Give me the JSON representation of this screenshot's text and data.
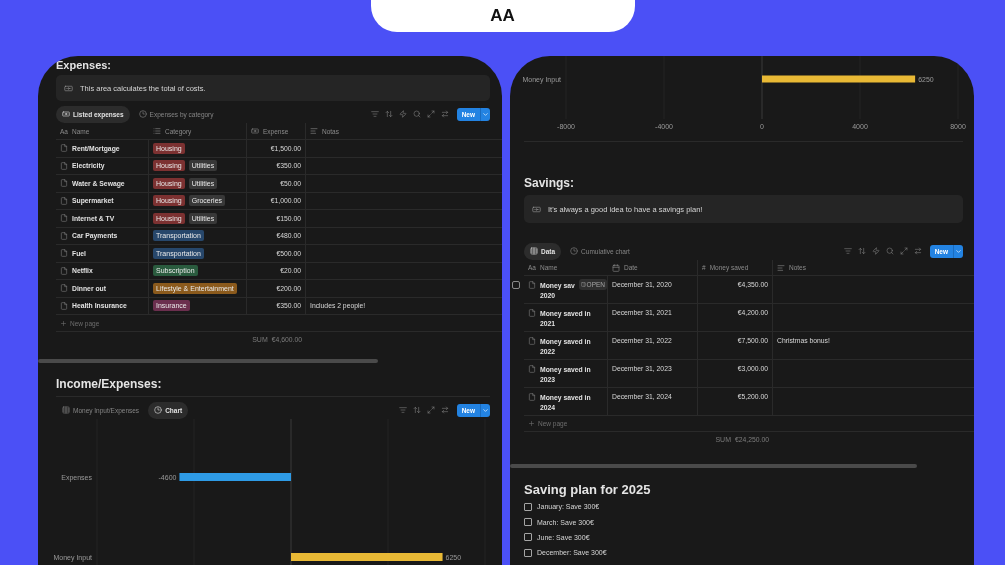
{
  "header": {
    "title": "AA"
  },
  "expenses": {
    "title": "Expenses:",
    "callout": "This area calculates the total of costs.",
    "views": [
      {
        "label": "Listed expenses",
        "kind": "money",
        "selected": true
      },
      {
        "label": "Expenses by category",
        "kind": "chart",
        "selected": false
      }
    ],
    "new_button": "New",
    "columns": [
      {
        "label": "Name",
        "kind": "title",
        "glyph": "Aa"
      },
      {
        "label": "Category",
        "kind": "multi_select"
      },
      {
        "label": "Expense",
        "kind": "currency"
      },
      {
        "label": "Notas",
        "kind": "text"
      }
    ],
    "rows": [
      {
        "name": "Rent/Mortgage",
        "tags": [
          {
            "label": "Housing",
            "color": "#7c3131"
          }
        ],
        "expense": "€1,500.00"
      },
      {
        "name": "Electricity",
        "tags": [
          {
            "label": "Housing",
            "color": "#7c3131"
          },
          {
            "label": "Utilities",
            "color": "#383838"
          }
        ],
        "expense": "€350.00"
      },
      {
        "name": "Water & Sewage",
        "tags": [
          {
            "label": "Housing",
            "color": "#7c3131"
          },
          {
            "label": "Utilities",
            "color": "#383838"
          }
        ],
        "expense": "€50.00"
      },
      {
        "name": "Supermarket",
        "tags": [
          {
            "label": "Housing",
            "color": "#7c3131"
          },
          {
            "label": "Groceries",
            "color": "#383838"
          }
        ],
        "expense": "€1,000.00"
      },
      {
        "name": "Internet & TV",
        "tags": [
          {
            "label": "Housing",
            "color": "#7c3131"
          },
          {
            "label": "Utilities",
            "color": "#383838"
          }
        ],
        "expense": "€150.00"
      },
      {
        "name": "Car Payments",
        "tags": [
          {
            "label": "Transportation",
            "color": "#27476b"
          }
        ],
        "expense": "€480.00"
      },
      {
        "name": "Fuel",
        "tags": [
          {
            "label": "Transportation",
            "color": "#27476b"
          }
        ],
        "expense": "€500.00"
      },
      {
        "name": "Netflix",
        "tags": [
          {
            "label": "Subscription",
            "color": "#2a5b3e"
          }
        ],
        "expense": "€20.00"
      },
      {
        "name": "Dinner out",
        "tags": [
          {
            "label": "Lifestyle & Entertainment",
            "color": "#8b5a1c"
          }
        ],
        "expense": "€200.00"
      },
      {
        "name": "Health Insurance",
        "tags": [
          {
            "label": "Insurance",
            "color": "#6b2f4e"
          }
        ],
        "expense": "€350.00",
        "notes": "Includes 2 people!"
      }
    ],
    "new_page": "New page",
    "sum_label": "SUM",
    "sum": "€4,600.00"
  },
  "income_expenses": {
    "title": "Income/Expenses:",
    "views": [
      {
        "label": "Money Input/Expenses",
        "kind": "table",
        "selected": false
      },
      {
        "label": "Chart",
        "kind": "chart",
        "selected": true
      }
    ],
    "new_button": "New",
    "chart_data": {
      "type": "bar",
      "orientation": "horizontal",
      "categories": [
        "Expenses",
        "Money Input"
      ],
      "data_labels": true,
      "series": [
        {
          "color": "#2e9be6",
          "values": [
            -4600,
            null
          ]
        },
        {
          "color": "#e9b935",
          "values": [
            null,
            6250
          ]
        }
      ]
    }
  },
  "income_chart_continued": {
    "chart_data": {
      "type": "bar",
      "orientation": "horizontal",
      "categories": [
        "Money Input"
      ],
      "xlim": [
        -8000,
        8000
      ],
      "xticks": [
        -8000,
        -4000,
        0,
        4000,
        8000
      ],
      "data_labels": true,
      "series": [
        {
          "color": "#e9b935",
          "values": [
            6250
          ]
        }
      ]
    }
  },
  "savings": {
    "title": "Savings:",
    "callout": "It's always a good idea to have a savings plan!",
    "views": [
      {
        "label": "Data",
        "kind": "table",
        "selected": true
      },
      {
        "label": "Cumulative chart",
        "kind": "chart",
        "selected": false
      }
    ],
    "new_button": "New",
    "columns": [
      {
        "label": "Name",
        "kind": "title",
        "glyph": "Aa"
      },
      {
        "label": "Date",
        "kind": "date"
      },
      {
        "label": "Money saved",
        "kind": "number",
        "glyph": "#"
      },
      {
        "label": "Notes",
        "kind": "text"
      }
    ],
    "rows": [
      {
        "name_lines": [
          "Money sav",
          "2020"
        ],
        "open_label": "OPEN",
        "selected": false,
        "date": "December 31, 2020",
        "amount": "€4,350.00"
      },
      {
        "name_lines": [
          "Money saved in",
          "2021"
        ],
        "selected": false,
        "date": "December 31, 2021",
        "amount": "€4,200.00"
      },
      {
        "name_lines": [
          "Money saved in",
          "2022"
        ],
        "selected": false,
        "date": "December 31, 2022",
        "amount": "€7,500.00",
        "notes": "Christmas bonus!"
      },
      {
        "name_lines": [
          "Money saved in",
          "2023"
        ],
        "selected": false,
        "date": "December 31, 2023",
        "amount": "€3,000.00"
      },
      {
        "name_lines": [
          "Money saved in",
          "2024"
        ],
        "selected": false,
        "date": "December 31, 2024",
        "amount": "€5,200.00"
      }
    ],
    "new_page": "New page",
    "sum_label": "SUM",
    "sum": "€24,250.00"
  },
  "plan": {
    "title": "Saving plan for 2025",
    "todos": [
      {
        "label": "January: Save 300€",
        "checked": false
      },
      {
        "label": "March: Save 300€",
        "checked": false
      },
      {
        "label": "June: Save 300€",
        "checked": false
      },
      {
        "label": "December: Save 300€",
        "checked": false
      }
    ]
  }
}
